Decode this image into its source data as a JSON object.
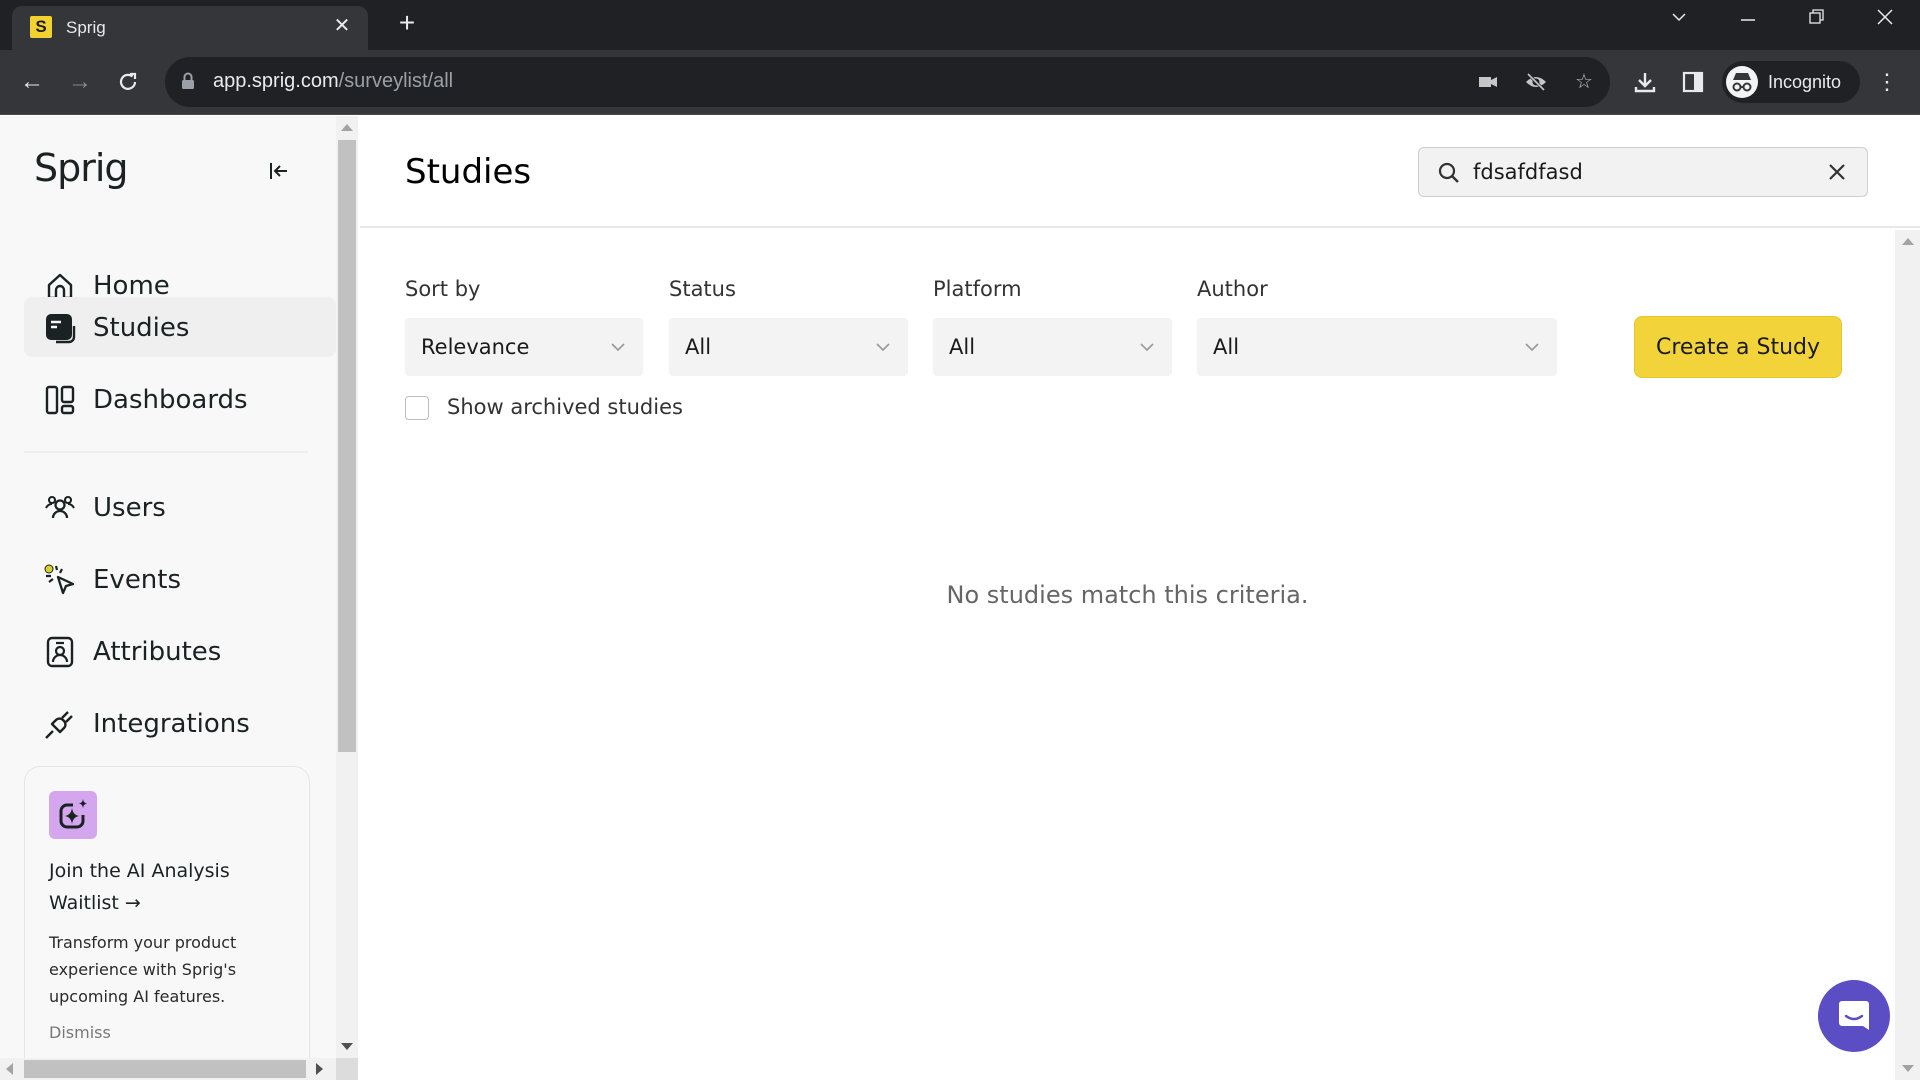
{
  "browser": {
    "tab_title": "Sprig",
    "tab_favicon_letter": "S",
    "url_host": "app.sprig.com",
    "url_path": "/surveylist/all",
    "profile_label": "Incognito"
  },
  "sidebar": {
    "logo": "Sprig",
    "items": [
      {
        "label": "Home",
        "icon": "home-icon"
      },
      {
        "label": "Studies",
        "icon": "studies-icon",
        "active": true
      },
      {
        "label": "Dashboards",
        "icon": "dashboards-icon"
      },
      {
        "label": "Users",
        "icon": "users-icon"
      },
      {
        "label": "Events",
        "icon": "events-icon"
      },
      {
        "label": "Attributes",
        "icon": "attributes-icon"
      },
      {
        "label": "Integrations",
        "icon": "integrations-icon"
      }
    ],
    "promo": {
      "title": "Join the AI Analysis Waitlist →",
      "description": "Transform your product experience with Sprig's upcoming AI features.",
      "dismiss": "Dismiss"
    }
  },
  "main": {
    "title": "Studies",
    "search": {
      "value": "fdsafdfasd"
    },
    "filters": [
      {
        "label": "Sort by",
        "value": "Relevance"
      },
      {
        "label": "Status",
        "value": "All"
      },
      {
        "label": "Platform",
        "value": "All"
      },
      {
        "label": "Author",
        "value": "All"
      }
    ],
    "create_button": "Create a Study",
    "show_archived_label": "Show archived studies",
    "show_archived_checked": false,
    "empty_message": "No studies match this criteria."
  },
  "colors": {
    "accent_yellow": "#f2d43a",
    "chat_purple": "#5b4dc4",
    "promo_icon_bg": "#d4a6ee",
    "events_dot": "#d9d22a"
  }
}
